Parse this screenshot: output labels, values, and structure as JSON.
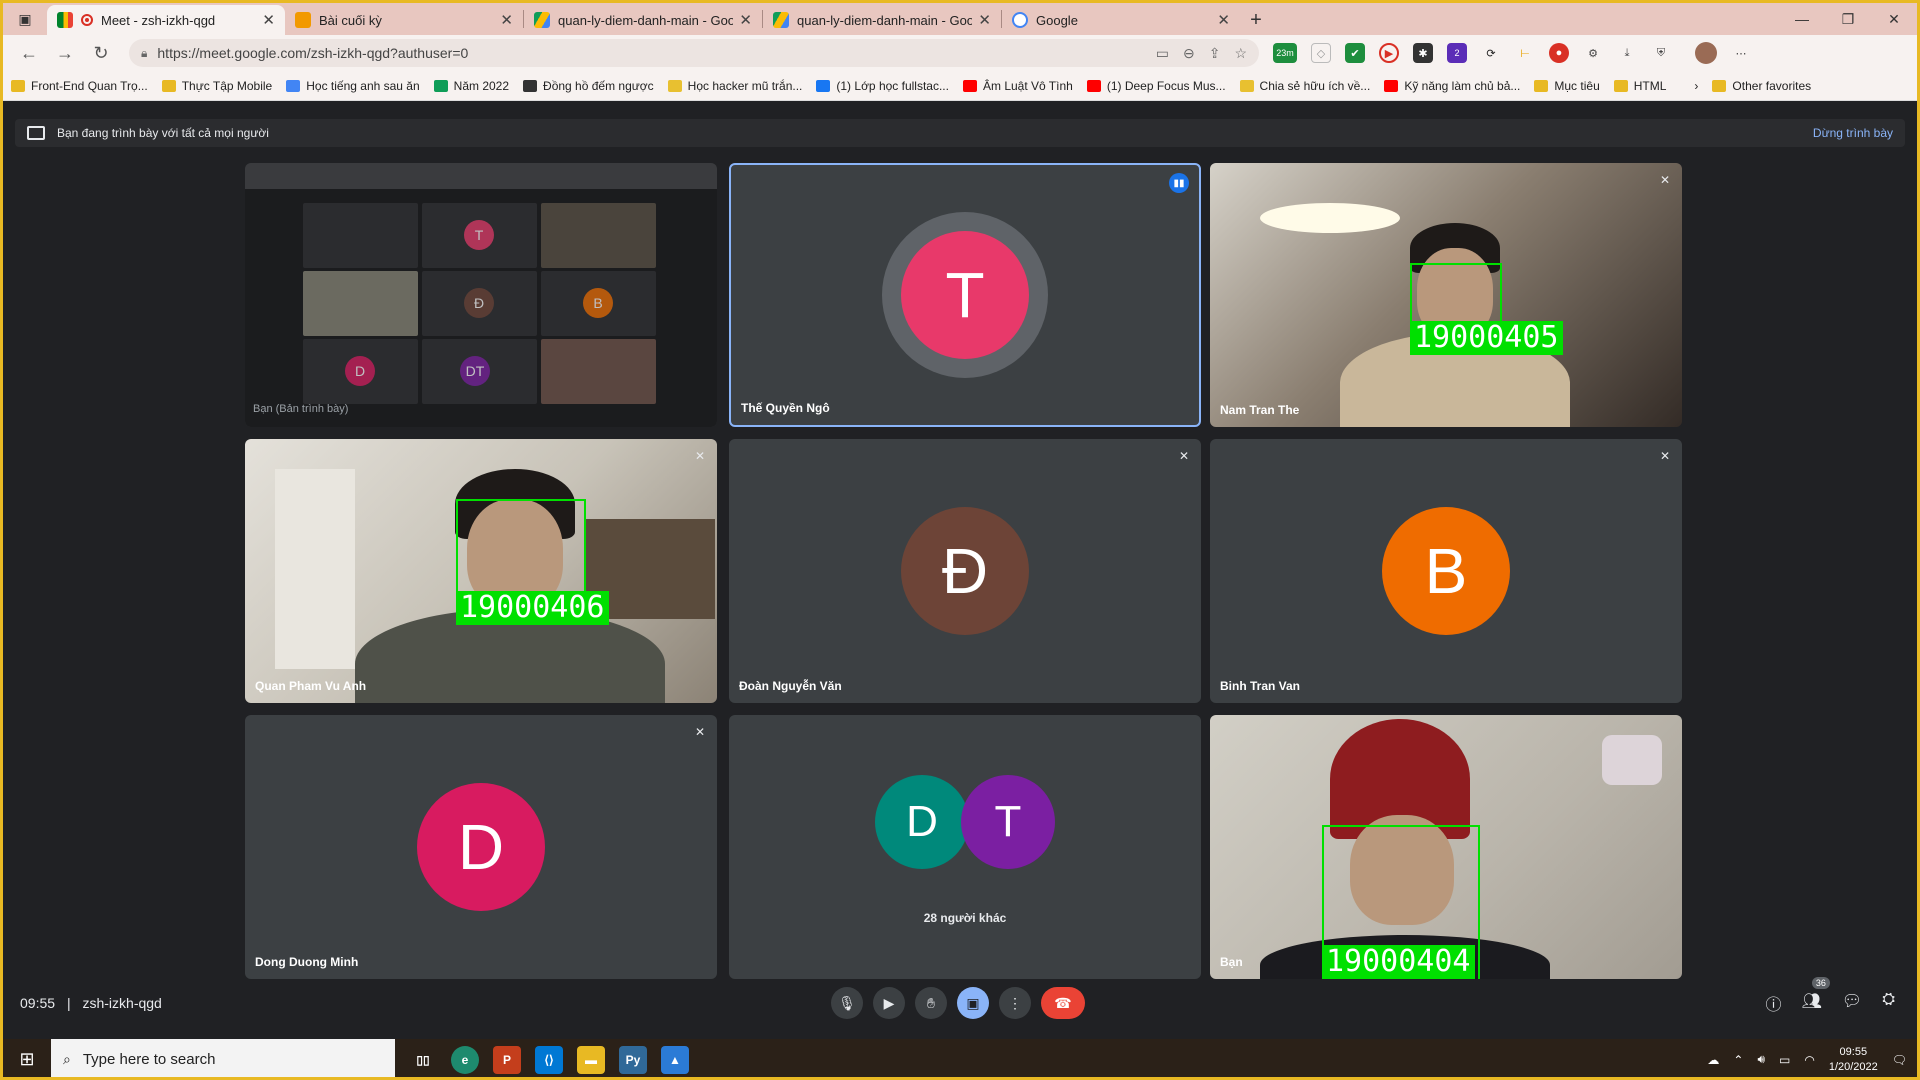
{
  "browser": {
    "tabs": [
      {
        "label": "Meet - zsh-izkh-qgd",
        "active": true
      },
      {
        "label": "Bài cuối kỳ",
        "active": false
      },
      {
        "label": "quan-ly-diem-danh-main - Goo",
        "active": false
      },
      {
        "label": "quan-ly-diem-danh-main - Goo",
        "active": false
      },
      {
        "label": "Google",
        "active": false
      }
    ],
    "url": "https://meet.google.com/zsh-izkh-qgd?authuser=0",
    "ext_badge": "23m",
    "ext_badge2": "2",
    "bookmarks": [
      {
        "label": "Front-End Quan Trọ...",
        "icon": "folder-icon"
      },
      {
        "label": "Thực Tập Mobile",
        "icon": "folder-icon"
      },
      {
        "label": "Học tiếng anh sau ăn",
        "icon": "search-icon"
      },
      {
        "label": "Năm 2022",
        "icon": "drive-icon"
      },
      {
        "label": "Đồng hồ đếm ngược",
        "icon": "clock-icon"
      },
      {
        "label": "Học hacker mũ trắn...",
        "icon": "page-icon"
      },
      {
        "label": "(1) Lớp học fullstac...",
        "icon": "facebook-icon"
      },
      {
        "label": "Âm Luật Vô Tình",
        "icon": "youtube-icon"
      },
      {
        "label": "(1) Deep Focus Mus...",
        "icon": "youtube-icon"
      },
      {
        "label": "Chia sẻ hữu ích về...",
        "icon": "page-icon"
      },
      {
        "label": "Kỹ năng làm chủ bả...",
        "icon": "youtube-icon"
      },
      {
        "label": "Mục tiêu",
        "icon": "folder-icon"
      },
      {
        "label": "HTML",
        "icon": "folder-icon"
      }
    ],
    "other_favorites": "Other favorites"
  },
  "meet": {
    "banner_text": "Bạn đang trình bày với tất cả mọi người",
    "stop_presenting": "Dừng trình bày",
    "self_presentation_label": "Bạn (Bản trình bày)",
    "tiles": [
      {
        "name": "Thế Quyền Ngô",
        "initial": "T",
        "color": "#e8396a"
      },
      {
        "name": "Nam Tran The",
        "box_id": "19000405"
      },
      {
        "name": "Quan Pham Vu Anh",
        "box_id": "19000406"
      },
      {
        "name": "Đoàn Nguyễn Văn",
        "initial": "Đ",
        "color": "#6d4437"
      },
      {
        "name": "Binh Tran Van",
        "initial": "B",
        "color": "#ef6c00"
      },
      {
        "name": "Dong Duong Minh",
        "initial": "D",
        "color": "#d81b60"
      },
      {
        "group_initials": [
          "D",
          "T"
        ],
        "group_colors": [
          "#00897b",
          "#7b1fa2"
        ],
        "others_label": "28 người khác"
      },
      {
        "name": "Bạn",
        "box_id": "19000404"
      }
    ],
    "meeting_time": "09:55",
    "meeting_code": "zsh-izkh-qgd",
    "separator": "|",
    "people_count": "36"
  },
  "taskbar": {
    "search_placeholder": "Type here to search",
    "time": "09:55",
    "date": "1/20/2022"
  }
}
